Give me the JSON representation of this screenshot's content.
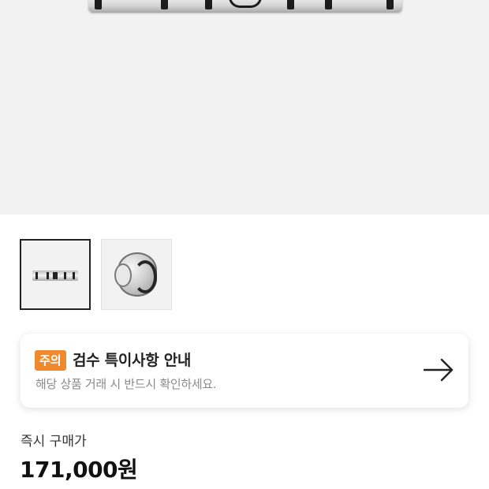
{
  "product": {
    "gallery": {
      "thumbnails": [
        {
          "icon": "ring-front-view",
          "selected": true
        },
        {
          "icon": "ring-side-view",
          "selected": false
        }
      ]
    }
  },
  "notice": {
    "badge": "주의",
    "title": "검수 특이사항 안내",
    "description": "해당 상품 거래 시 반드시 확인하세요.",
    "arrow_icon": "arrow-right-icon"
  },
  "price": {
    "label": "즉시 구매가",
    "value": "171,000원"
  },
  "colors": {
    "badge": "#f08a2f",
    "text_primary": "#222222",
    "text_secondary": "#8a8a8a",
    "image_bg": "#f2f2f2"
  }
}
